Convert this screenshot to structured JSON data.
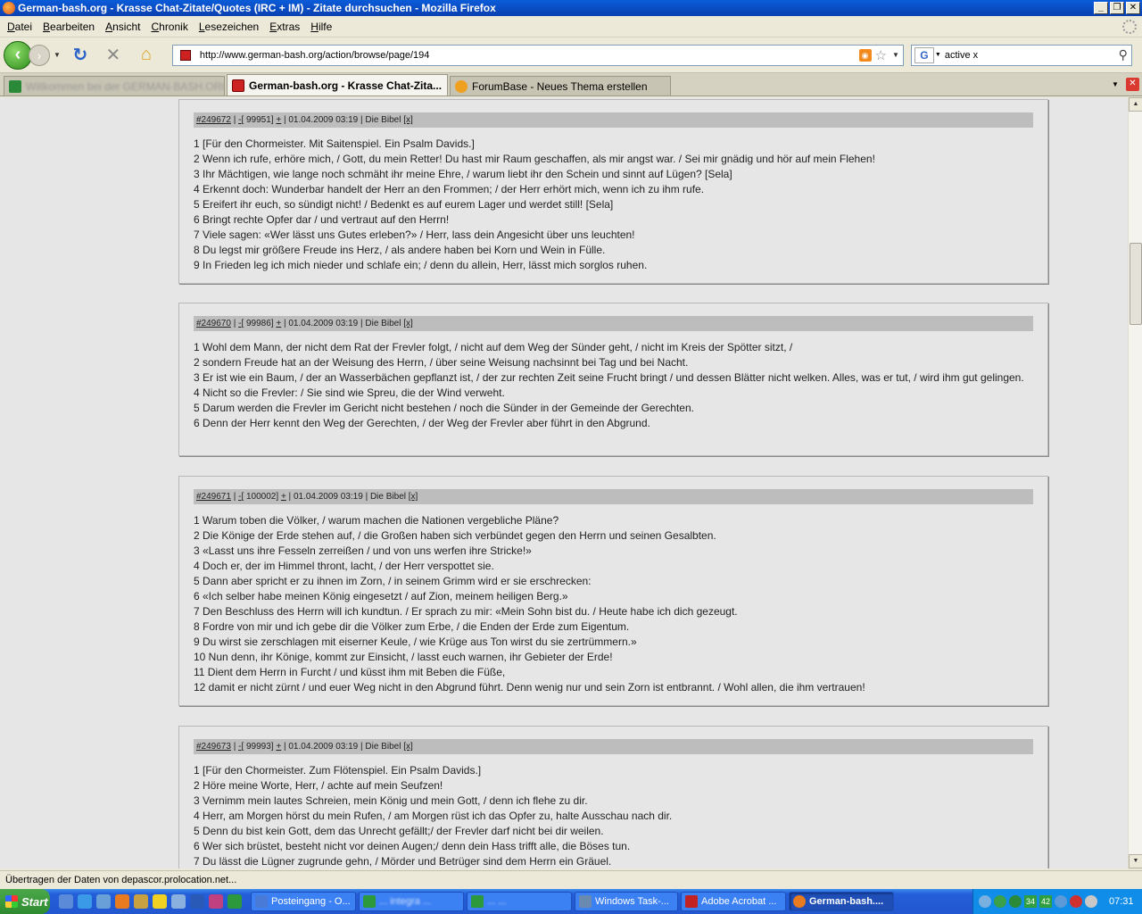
{
  "window": {
    "title": "German-bash.org - Krasse Chat-Zitate/Quotes (IRC + IM) - Zitate durchsuchen - Mozilla Firefox",
    "min_label": "_",
    "max_label": "❐",
    "close_label": "✕"
  },
  "menu": [
    "Datei",
    "Bearbeiten",
    "Ansicht",
    "Chronik",
    "Lesezeichen",
    "Extras",
    "Hilfe"
  ],
  "nav": {
    "url": "http://www.german-bash.org/action/browse/page/194",
    "search_value": "active x"
  },
  "tabs": [
    {
      "label": "Willkommen bei der GERMAN-BASH.ORG T...",
      "blurred": true
    },
    {
      "label": "German-bash.org - Krasse Chat-Zita...",
      "active": true
    },
    {
      "label": "ForumBase - Neues Thema erstellen"
    }
  ],
  "quotes": [
    {
      "id": "#249672",
      "minus": "-",
      "score": "[ 99951]",
      "plus": "+",
      "date": "01.04.2009 03:19",
      "author": "Die Bibel",
      "x": "[x]",
      "lines": [
        "1 [Für den Chormeister. Mit Saitenspiel. Ein Psalm Davids.]",
        "2 Wenn ich rufe, erhöre mich, / Gott, du mein Retter! Du hast mir Raum geschaffen, als mir angst war. / Sei mir gnädig und hör auf mein Flehen!",
        "3 Ihr Mächtigen, wie lange noch schmäht ihr meine Ehre, / warum liebt ihr den Schein und sinnt auf Lügen? [Sela]",
        "4 Erkennt doch: Wunderbar handelt der Herr an den Frommen; / der Herr erhört mich, wenn ich zu ihm rufe.",
        "5 Ereifert ihr euch, so sündigt nicht! / Bedenkt es auf eurem Lager und werdet still! [Sela]",
        "6 Bringt rechte Opfer dar / und vertraut auf den Herrn!",
        "7 Viele sagen: «Wer lässt uns Gutes erleben?» / Herr, lass dein Angesicht über uns leuchten!",
        "8 Du legst mir größere Freude ins Herz, / als andere haben bei Korn und Wein in Fülle.",
        "9 In Frieden leg ich mich nieder und schlafe ein; / denn du allein, Herr, lässt mich sorglos ruhen."
      ]
    },
    {
      "id": "#249670",
      "minus": "-",
      "score": "[ 99986]",
      "plus": "+",
      "date": "01.04.2009 03:19",
      "author": "Die Bibel",
      "x": "[x]",
      "lines": [
        "1 Wohl dem Mann, der nicht dem Rat der Frevler folgt, / nicht auf dem Weg der Sünder geht, / nicht im Kreis der Spötter sitzt, /",
        "2 sondern Freude hat an der Weisung des Herrn, / über seine Weisung nachsinnt bei Tag und bei Nacht.",
        "3 Er ist wie ein Baum, / der an Wasserbächen gepflanzt ist, / der zur rechten Zeit seine Frucht bringt / und dessen Blätter nicht welken. Alles, was er tut, / wird ihm gut gelingen.",
        "4 Nicht so die Frevler: / Sie sind wie Spreu, die der Wind verweht.",
        "5 Darum werden die Frevler im Gericht nicht bestehen / noch die Sünder in der Gemeinde der Gerechten.",
        "6 Denn der Herr kennt den Weg der Gerechten, / der Weg der Frevler aber führt in den Abgrund."
      ]
    },
    {
      "id": "#249671",
      "minus": "-",
      "score": "[ 100002]",
      "plus": "+",
      "date": "01.04.2009 03:19",
      "author": "Die Bibel",
      "x": "[x]",
      "lines": [
        "1 Warum toben die Völker, / warum machen die Nationen vergebliche Pläne?",
        "2 Die Könige der Erde stehen auf, / die Großen haben sich verbündet gegen den Herrn und seinen Gesalbten.",
        "3 «Lasst uns ihre Fesseln zerreißen / und von uns werfen ihre Stricke!»",
        "4 Doch er, der im Himmel thront, lacht, / der Herr verspottet sie.",
        "5 Dann aber spricht er zu ihnen im Zorn, / in seinem Grimm wird er sie erschrecken:",
        "6 «Ich selber habe meinen König eingesetzt / auf Zion, meinem heiligen Berg.»",
        "7 Den Beschluss des Herrn will ich kundtun. / Er sprach zu mir: «Mein Sohn bist du. / Heute habe ich dich gezeugt.",
        "8 Fordre von mir und ich gebe dir die Völker zum Erbe, / die Enden der Erde zum Eigentum.",
        "9 Du wirst sie zerschlagen mit eiserner Keule, / wie Krüge aus Ton wirst du sie zertrümmern.»",
        "10 Nun denn, ihr Könige, kommt zur Einsicht, / lasst euch warnen, ihr Gebieter der Erde!",
        "11 Dient dem Herrn in Furcht / und küsst ihm mit Beben die Füße,",
        "12 damit er nicht zürnt / und euer Weg nicht in den Abgrund führt. Denn wenig nur und sein Zorn ist entbrannt. / Wohl allen, die ihm vertrauen!"
      ]
    },
    {
      "id": "#249673",
      "minus": "-",
      "score": "[ 99993]",
      "plus": "+",
      "date": "01.04.2009 03:19",
      "author": "Die Bibel",
      "x": "[x]",
      "lines": [
        "1 [Für den Chormeister. Zum Flötenspiel. Ein Psalm Davids.]",
        "2 Höre meine Worte, Herr, / achte auf mein Seufzen!",
        "3 Vernimm mein lautes Schreien, mein König und mein Gott, / denn ich flehe zu dir.",
        "4 Herr, am Morgen hörst du mein Rufen, / am Morgen rüst ich das Opfer zu, halte Ausschau nach dir.",
        "5 Denn du bist kein Gott, dem das Unrecht gefällt;/ der Frevler darf nicht bei dir weilen.",
        "6 Wer sich brüstet, besteht nicht vor deinen Augen;/ denn dein Hass trifft alle, die Böses tun.",
        "7 Du lässt die Lügner zugrunde gehn, / Mörder und Betrüger sind dem Herrn ein Gräuel."
      ]
    }
  ],
  "status": "Übertragen der Daten von depascor.prolocation.net...",
  "taskbar": {
    "start": "Start",
    "tasks": [
      {
        "label": "Posteingang - O...",
        "color": "#4a7ad8"
      },
      {
        "label": "... integra ...",
        "color": "#2c9a3c",
        "blurred": true
      },
      {
        "label": "... ...",
        "color": "#2c9a3c",
        "blurred": true
      },
      {
        "label": "Windows Task-...",
        "color": "#6a8ab0"
      },
      {
        "label": "Adobe Acrobat ...",
        "color": "#c22222"
      },
      {
        "label": "German-bash....",
        "color": "#e87a20",
        "active": true
      }
    ],
    "tray_nums": [
      "34",
      "42"
    ],
    "clock": "07:31"
  },
  "colors": {
    "titlebar": "#0a4fc8",
    "content_bg": "#e6e6e6",
    "quote_header_bg": "#bdbdbd",
    "taskbar": "#235ed8"
  }
}
